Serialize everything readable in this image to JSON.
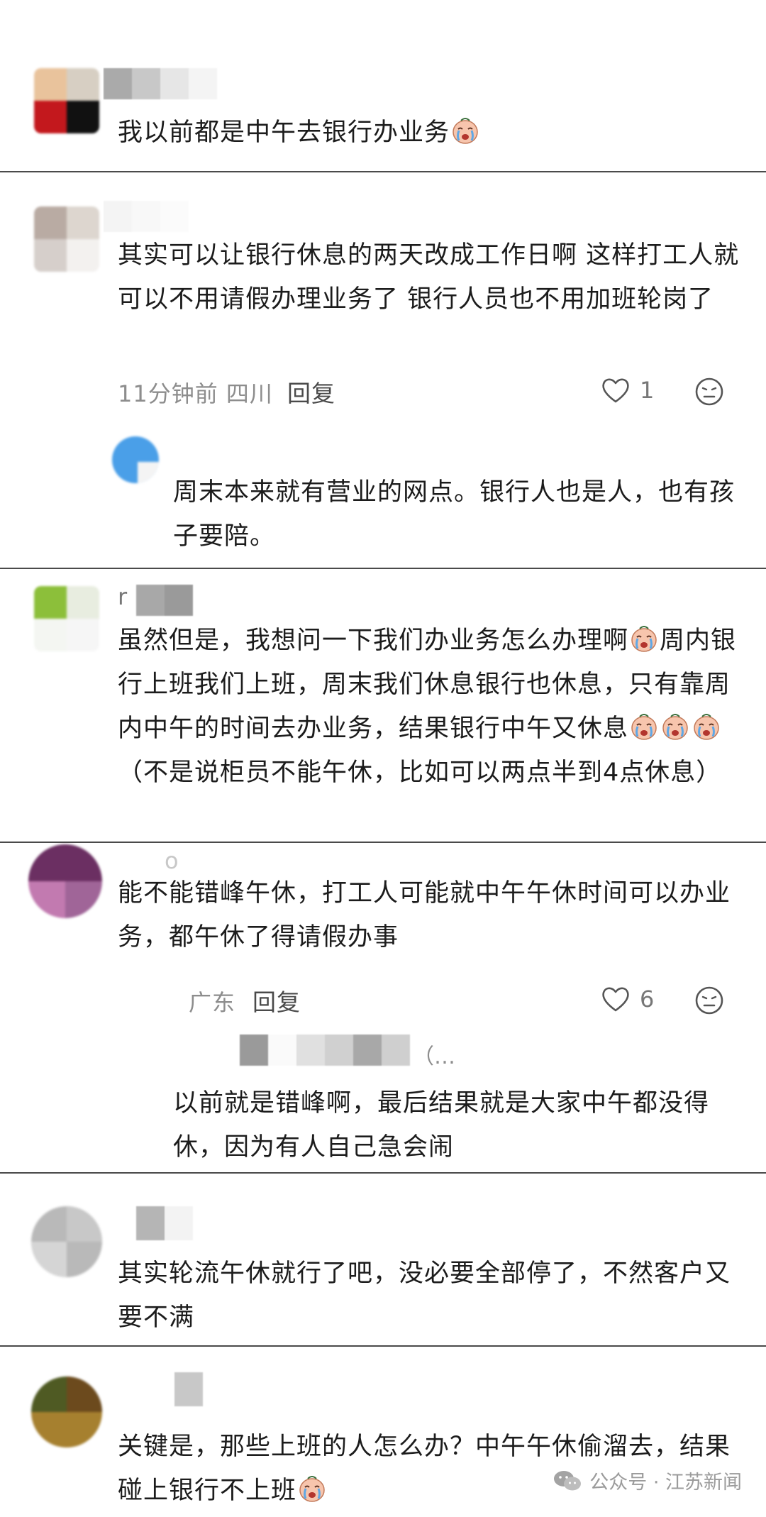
{
  "comments": [
    {
      "text": "我以前都是中午去银行办业务",
      "emoji_count": 1
    },
    {
      "text": "其实可以让银行休息的两天改成工作日啊 这样打工人就可以不用请假办理业务了 银行人员也不用加班轮岗了",
      "meta": "11分钟前  四川",
      "reply_label": "回复",
      "likes": "1",
      "reply": {
        "text": "周末本来就有营业的网点。银行人也是人，也有孩子要陪。"
      }
    },
    {
      "name_partial": "r",
      "text_part1": "虽然但是，我想问一下我们办业务怎么办理啊",
      "text_part2": "周内银行上班我们上班，周末我们休息银行也休息，只有靠周内中午的时间去办业务，结果银行中午又休息",
      "text_part3": "（不是说柜员不能午休，比如可以两点半到4点休息）"
    },
    {
      "name_partial": "o",
      "text": "能不能错峰午休，打工人可能就中午午休时间可以办业务，都午休了得请假办事",
      "meta": "广东",
      "reply_label": "回复",
      "likes": "6",
      "reply": {
        "name_partial": "（…",
        "text": "以前就是错峰啊，最后结果就是大家中午都没得休，因为有人自己急会闹"
      }
    },
    {
      "text": "其实轮流午休就行了吧，没必要全部停了，不然客户又要不满"
    },
    {
      "text": "关键是，那些上班的人怎么办？中午午休偷溜去，结果碰上银行不上班"
    }
  ],
  "watermark": {
    "text": "公众号 · 江苏新闻"
  },
  "icons": {
    "like": "heart-outline-icon",
    "dislike": "frown-face-icon",
    "emoji": "crying-face-emoji",
    "watermark": "wechat-icon"
  },
  "colors": {
    "divider": "#4a4a4a",
    "text": "#1c1c1c",
    "meta": "#8d8d8d",
    "emoji_face": "#f6c2a8",
    "tears": "#6aaee8"
  }
}
